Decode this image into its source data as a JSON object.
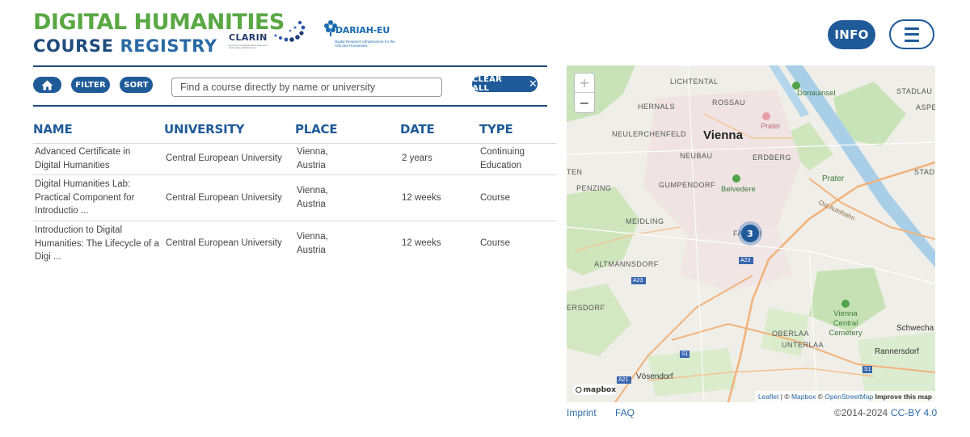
{
  "header": {
    "logo_line1": "DIGITAL HUMANITIES",
    "logo_line2a": "COURSE ",
    "logo_line2b": "REGISTRY",
    "partners": {
      "clarin": {
        "name": "CLARIN",
        "sub": "Common Language Resources and Technology Infrastructure"
      },
      "dariah": {
        "name": "DARIAH-EU",
        "sub": "Digital Research Infrastructure for the Arts and Humanities"
      }
    },
    "info_label": "INFO",
    "menu_icon": "hamburger-icon"
  },
  "toolbar": {
    "home_icon": "home-icon",
    "filter_label": "FILTER",
    "sort_label": "SORT",
    "search_placeholder": "Find a course directly by name or university",
    "search_value": "",
    "clear_label": "CLEAR ALL",
    "clear_icon": "close-icon"
  },
  "table": {
    "headers": [
      "NAME",
      "UNIVERSITY",
      "PLACE",
      "DATE",
      "TYPE"
    ],
    "rows": [
      {
        "name": "Advanced Certificate in Digital Humanities",
        "university": "Central European University",
        "place": "Vienna, Austria",
        "date": "2 years",
        "type": "Continuing Education"
      },
      {
        "name": "Digital Humanities Lab: Practical Component for Introductio ...",
        "university": "Central European University",
        "place": "Vienna, Austria",
        "date": "12 weeks",
        "type": "Course"
      },
      {
        "name": "Introduction to Digital Humanities: The Lifecycle of a Digi ...",
        "university": "Central European University",
        "place": "Vienna, Austria",
        "date": "12 weeks",
        "type": "Course"
      }
    ]
  },
  "map": {
    "zoom_in": "+",
    "zoom_out": "−",
    "cluster_count": "3",
    "labels": {
      "vienna": "Vienna",
      "lichtental": "LICHTENTAL",
      "rossau": "ROSSAU",
      "hernals": "HERNALS",
      "donauinsel": "Donauinsel",
      "stadlau": "STADLAU",
      "prater_poi": "Prater",
      "prater": "Prater",
      "neulerchenfeld": "NEULERCHENFELD",
      "neubau": "NEUBAU",
      "erdberg": "ERDBERG",
      "penzing": "PENZING",
      "gumpendorf": "GUMPENDORF",
      "belvedere": "Belvedere",
      "ost_autobahn": "Ost Autobahn",
      "meidling": "MEIDLING",
      "favoriten": "FAVORI",
      "altmannsdorf": "ALTMANNSDORF",
      "oberlaa": "OBERLAA",
      "unterlaa": "UNTERLAA",
      "vienna_central_cemetery": "Vienna Central Cemetery",
      "schwechat": "Schwecha",
      "rannersdorf": "Rannersdorf",
      "vosendorf": "Vösendorf",
      "gersdorf": "ERSDORF",
      "aspern": "ASPE",
      "stadt": "STADT",
      "ten": "TEN",
      "a23": "A23",
      "a21": "A21",
      "s1": "S1"
    },
    "attribution": {
      "leaflet": "Leaflet",
      "sep1": " | © ",
      "mapbox": "Mapbox",
      "sep2": " © ",
      "osm": "OpenStreetMap",
      "improve": "Improve this map"
    },
    "logo": "mapbox"
  },
  "footer": {
    "imprint": "Imprint",
    "faq": "FAQ",
    "copyright": "©2014-2024",
    "license": "CC-BY 4.0"
  },
  "colors": {
    "brand_green": "#5aa844",
    "brand_blue": "#1f5a99",
    "navy": "#1f4b7e"
  }
}
